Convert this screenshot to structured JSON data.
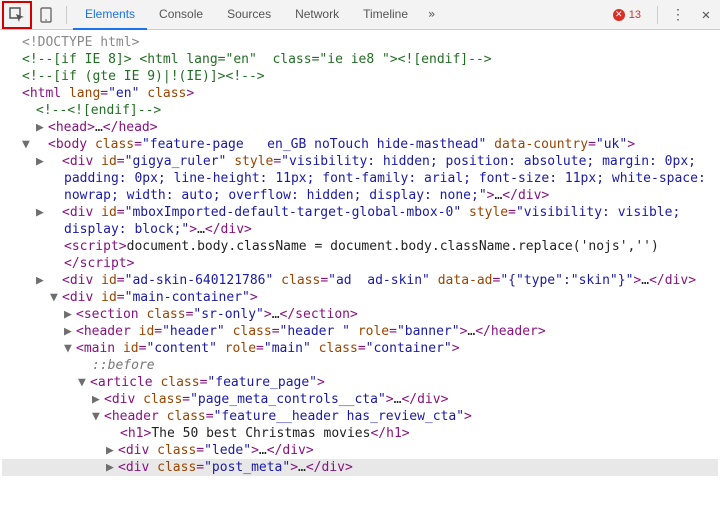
{
  "toolbar": {
    "tabs": [
      "Elements",
      "Console",
      "Sources",
      "Network",
      "Timeline"
    ],
    "active_tab": 0,
    "error_count": "13"
  },
  "glyphs": {
    "triangle_right": "▶",
    "triangle_down": "▼",
    "ellipsis": "…",
    "more": "»",
    "kebab": "⋮",
    "close": "✕"
  },
  "tree": {
    "l00": "<!DOCTYPE html>",
    "l01": "<!--[if IE 8]> <html lang=\"en\"  class=\"ie ie8 \"><![endif]-->",
    "l02": "<!--[if (gte IE 9)|!(IE)]><!-->",
    "l03_open": "<html ",
    "l03_a1n": "lang",
    "l03_a1v": "\"en\"",
    "l03_a2n": "class",
    "l04": "<!--<![endif]-->",
    "l05_open": "<head>",
    "l05_close": "</head>",
    "l06_open": "<body ",
    "l06_a1n": "class",
    "l06_a1v": "\"feature-page   en_GB noTouch hide-masthead\"",
    "l06_a2n": "data-country",
    "l06_a2v": "\"uk\"",
    "l07_pre": "<div ",
    "l07_idn": "id",
    "l07_idv": "\"gigya_ruler\"",
    "l07_stn": "style",
    "l07_stv": "\"visibility: hidden; position: absolute; margin: 0px; padding: 0px; line-height: 11px; font-family: arial; font-size: 11px; white-space: nowrap; width: auto; overflow: hidden; display: none;\"",
    "l07_close": "</div>",
    "l08_pre": "<div ",
    "l08_idn": "id",
    "l08_idv": "\"mboxImported-default-target-global-mbox-0\"",
    "l08_stn": "style",
    "l08_stv": "\"visibility: visible; display: block;\"",
    "l08_close": "</div>",
    "l09_open": "<script>",
    "l09_txt": "document.body.className = document.body.className.replace('nojs','')",
    "l09_close": "</script>",
    "l10_pre": "<div ",
    "l10_idn": "id",
    "l10_idv": "\"ad-skin-640121786\"",
    "l10_cln": "class",
    "l10_clv": "\"ad  ad-skin\"",
    "l10_dan": "data-ad",
    "l10_dav": "\"{\"type\":\"skin\"}\"",
    "l10_close": "</div>",
    "l11_pre": "<div ",
    "l11_idn": "id",
    "l11_idv": "\"main-container\"",
    "l12_pre": "<section ",
    "l12_cln": "class",
    "l12_clv": "\"sr-only\"",
    "l12_close": "</section>",
    "l13_pre": "<header ",
    "l13_idn": "id",
    "l13_idv": "\"header\"",
    "l13_cln": "class",
    "l13_clv": "\"header \"",
    "l13_rln": "role",
    "l13_rlv": "\"banner\"",
    "l13_close": "</header>",
    "l14_pre": "<main ",
    "l14_idn": "id",
    "l14_idv": "\"content\"",
    "l14_rln": "role",
    "l14_rlv": "\"main\"",
    "l14_cln": "class",
    "l14_clv": "\"container\"",
    "l15": "::before",
    "l16_pre": "<article ",
    "l16_cln": "class",
    "l16_clv": "\"feature_page\"",
    "l17_pre": "<div ",
    "l17_cln": "class",
    "l17_clv": "\"page_meta_controls__cta\"",
    "l17_close": "</div>",
    "l18_pre": "<header ",
    "l18_cln": "class",
    "l18_clv": "\"feature__header has_review_cta\"",
    "l19_open": "<h1>",
    "l19_txt": "The 50 best Christmas movies",
    "l19_close": "</h1>",
    "l20_pre": "<div ",
    "l20_cln": "class",
    "l20_clv": "\"lede\"",
    "l20_close": "</div>",
    "l21_pre": "<div ",
    "l21_cln": "class",
    "l21_clv": "\"post_meta\"",
    "l21_close": "</div>"
  }
}
